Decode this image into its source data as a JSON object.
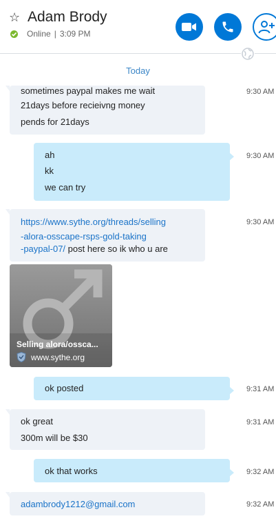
{
  "header": {
    "contact_name": "Adam Brody",
    "status": "Online",
    "separator": "|",
    "time": "3:09 PM",
    "accent_color": "#0078d7",
    "presence_color": "#7cb82f"
  },
  "day_label": "Today",
  "messages": [
    {
      "dir": "in",
      "lines": [
        "sometimes paypal makes me wait",
        "21days before recieivng money",
        "pends for 21days"
      ],
      "time": "9:30 AM"
    },
    {
      "dir": "out",
      "lines": [
        "ah",
        "kk",
        "we can try"
      ],
      "time": "9:30 AM"
    },
    {
      "dir": "in",
      "link_lines": [
        "https://www.sythe.org/threads/selling",
        "-alora-osscape-rsps-gold-taking",
        "-paypal-07/"
      ],
      "trailing_text": " post here so ik who u are",
      "time": "9:30 AM"
    },
    {
      "dir": "out",
      "lines": [
        "ok posted"
      ],
      "time": "9:31 AM"
    },
    {
      "dir": "in",
      "lines": [
        "ok great",
        "300m will be $30"
      ],
      "time": "9:31 AM"
    },
    {
      "dir": "out",
      "lines": [
        "ok that works"
      ],
      "time": "9:32 AM"
    },
    {
      "dir": "in",
      "link_lines": [
        "adambrody1212@gmail.com"
      ],
      "time": "9:32 AM"
    }
  ],
  "link_preview": {
    "title": "Selling alora/ossca...",
    "site": "www.sythe.org"
  },
  "icons": [
    "star-icon",
    "video-call-icon",
    "audio-call-icon",
    "add-person-icon",
    "globe-icon",
    "shield-icon"
  ]
}
